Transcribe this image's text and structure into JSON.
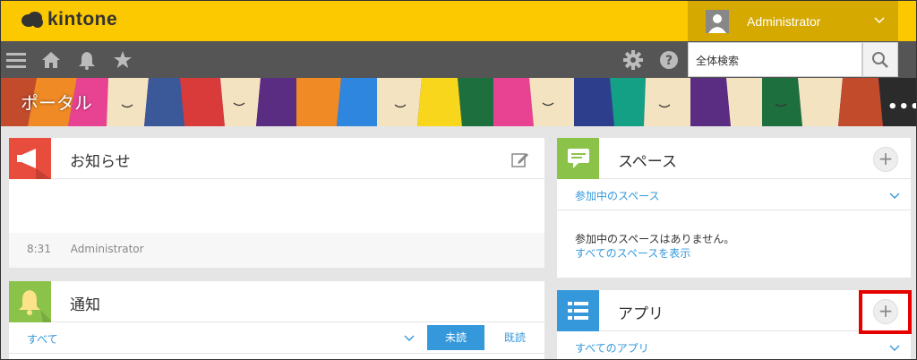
{
  "header": {
    "logo_text": "kintone",
    "user_name": "Administrator"
  },
  "nav": {
    "search_placeholder": "全体検索"
  },
  "banner": {
    "title": "ポータル",
    "more": "•••"
  },
  "notice": {
    "title": "お知らせ",
    "time": "8:31",
    "author": "Administrator"
  },
  "notifications": {
    "title": "通知",
    "filter_all": "すべて",
    "tab_unread": "未読",
    "tab_read": "既読"
  },
  "space": {
    "title": "スペース",
    "subheader": "参加中のスペース",
    "empty_message": "参加中のスペースはありません。",
    "show_all_link": "すべてのスペースを表示"
  },
  "apps": {
    "title": "アプリ",
    "subheader": "すべてのアプリ"
  },
  "colors": {
    "top_bar": "#fcc800",
    "user_area": "#d5a900",
    "nav_bar": "#555555",
    "notice_icon_bg": "#e74c3c",
    "notification_icon_bg": "#8bc34a",
    "space_icon_bg": "#8bc34a",
    "apps_icon_bg": "#3498db",
    "link": "#3498db",
    "highlight": "#e60000"
  }
}
